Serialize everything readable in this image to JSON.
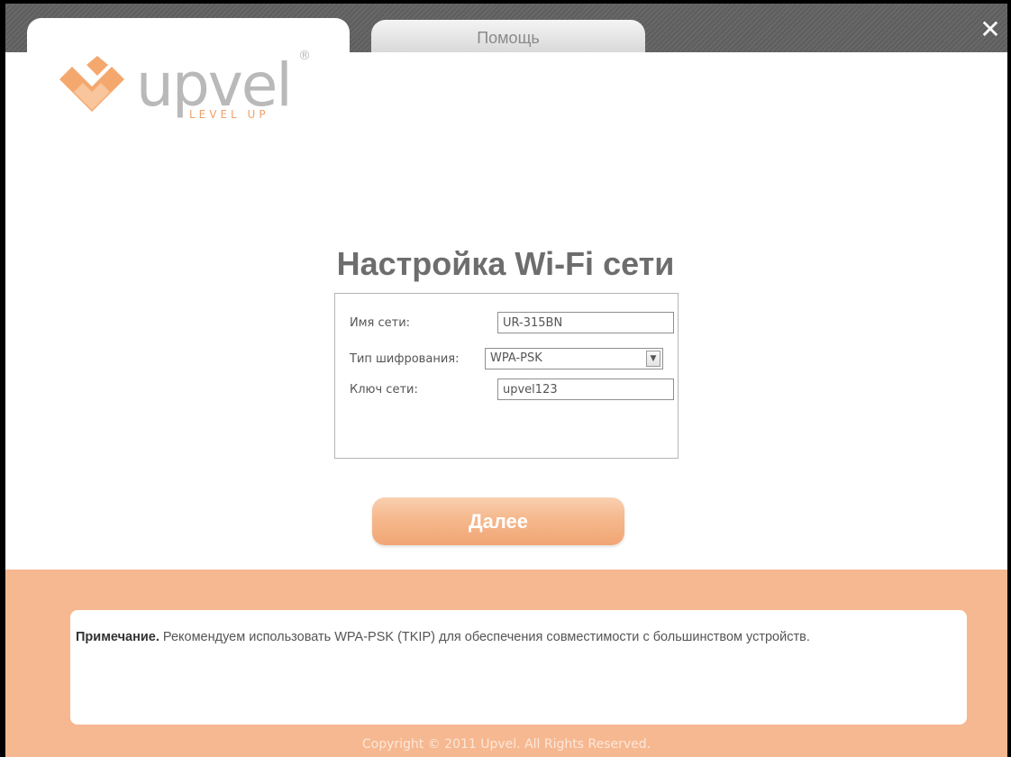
{
  "window": {
    "help_tab_label": "Помощь",
    "close_symbol": "✕"
  },
  "logo": {
    "wordmark": "upvel",
    "registered_mark": "®",
    "tagline": "LEVEL UP"
  },
  "page": {
    "title": "Настройка Wi-Fi сети"
  },
  "form": {
    "network_name_label": "Имя сети:",
    "network_name_value": "UR-315BN",
    "encryption_label": "Тип шифрования:",
    "encryption_value": "WPA-PSK",
    "key_label": "Ключ сети:",
    "key_value": "upvel123"
  },
  "actions": {
    "next_label": "Далее"
  },
  "footer": {
    "note_title": "Примечание.",
    "note_body": " Рекомендуем использовать WPA-PSK (TKIP) для обеспечения совместимости с большинством устройств.",
    "copyright": "Copyright © 2011 Upvel. All Rights Reserved."
  },
  "colors": {
    "accent_orange": "#f6b891",
    "button_orange": "#f5b88c",
    "title_gray": "#6d6d6d",
    "topbar_gray": "#646464"
  },
  "icons": {
    "close": "close-icon",
    "dropdown": "chevron-down-icon",
    "logo_mark": "upvel-chevron-logo"
  }
}
